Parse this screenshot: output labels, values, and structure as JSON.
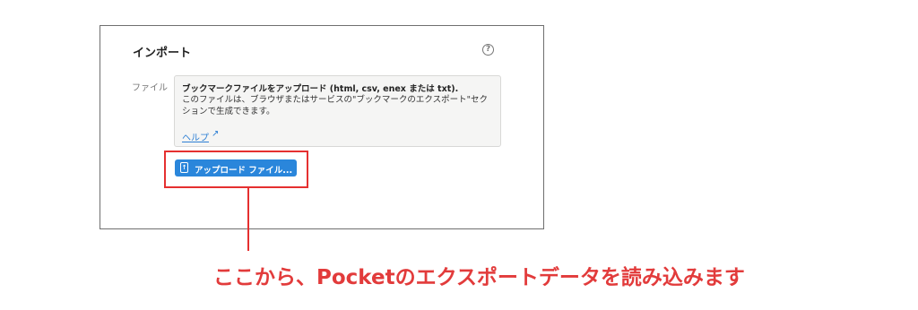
{
  "import_panel": {
    "title": "インポート",
    "help_icon": "question-circle-icon",
    "file_label": "ファイル",
    "info": {
      "heading": "ブックマークファイルをアップロード (html, csv, enex または txt).",
      "body": "このファイルは、ブラウザまたはサービスの\"ブックマークのエクスポート\"セクションで生成できます。",
      "link_label": "ヘルプ",
      "link_arrow": "↗"
    },
    "upload_button": {
      "icon": "upload-icon",
      "icon_glyph": "↑",
      "label": "アップロード ファイル..."
    }
  },
  "annotation": {
    "caption": "ここから、Pocketのエクスポートデータを読み込みます",
    "color": "#e53030"
  }
}
